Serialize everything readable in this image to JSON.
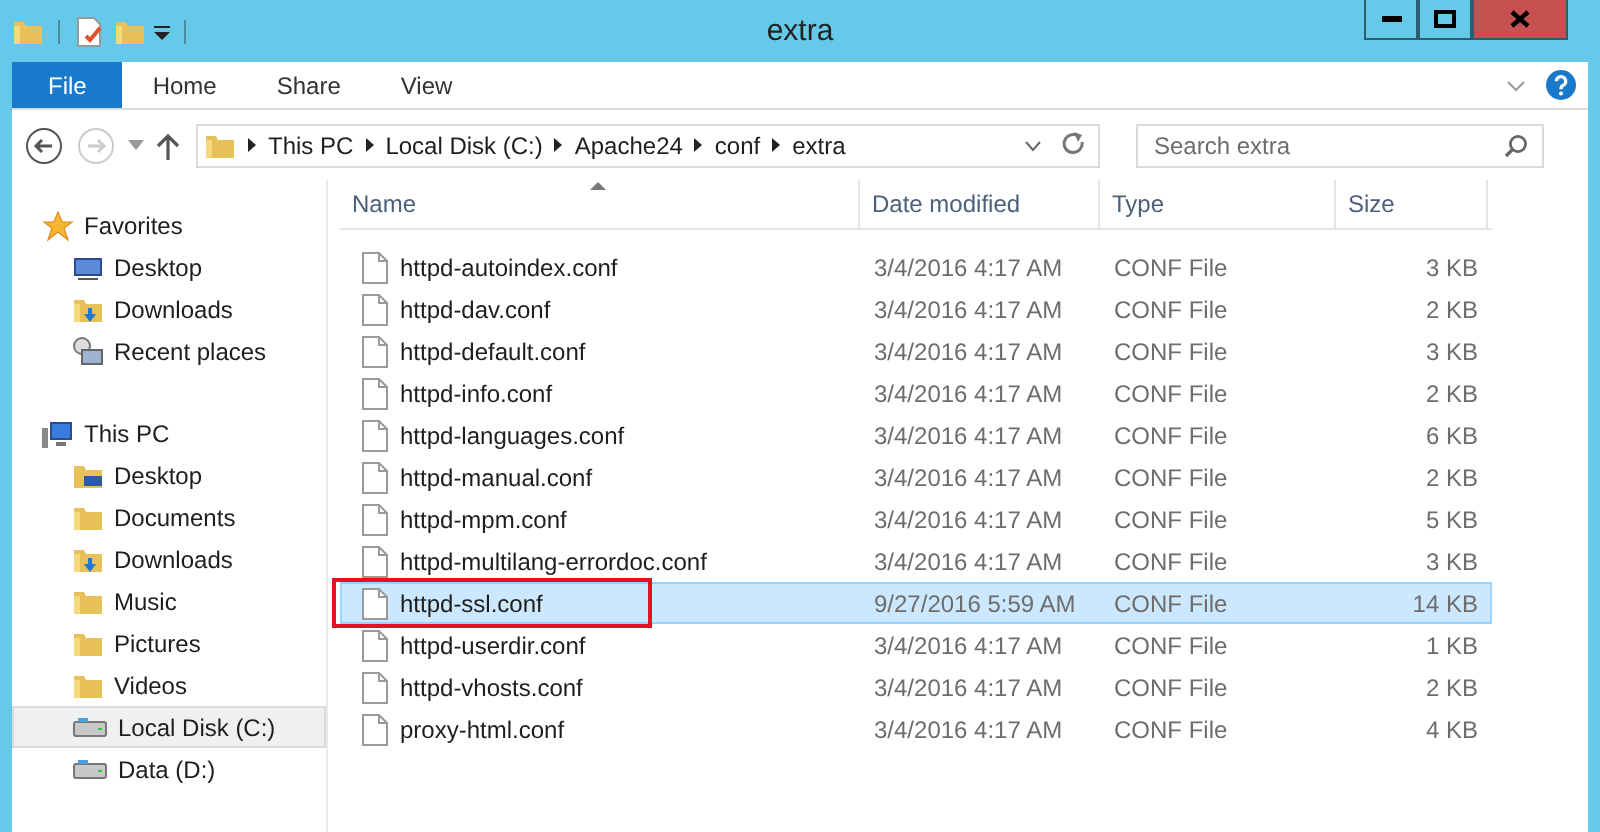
{
  "window": {
    "title": "extra"
  },
  "ribbon_tabs": [
    {
      "label": "File",
      "kind": "file",
      "selected": false
    },
    {
      "label": "Home",
      "kind": "tab",
      "selected": false
    },
    {
      "label": "Share",
      "kind": "tab",
      "selected": false
    },
    {
      "label": "View",
      "kind": "tab",
      "selected": false
    }
  ],
  "address": {
    "crumbs": [
      "This PC",
      "Local Disk (C:)",
      "Apache24",
      "conf",
      "extra"
    ]
  },
  "search": {
    "placeholder": "Search extra"
  },
  "sidebar": {
    "groups": [
      {
        "label": "Favorites",
        "kind": "favorites",
        "children": [
          {
            "label": "Desktop",
            "kind": "desktop",
            "selected": false
          },
          {
            "label": "Downloads",
            "kind": "downloads",
            "selected": false
          },
          {
            "label": "Recent places",
            "kind": "recent",
            "selected": false
          }
        ]
      },
      {
        "label": "This PC",
        "kind": "pc",
        "children": [
          {
            "label": "Desktop",
            "kind": "desktop-folder",
            "selected": false
          },
          {
            "label": "Documents",
            "kind": "folder",
            "selected": false
          },
          {
            "label": "Downloads",
            "kind": "downloads",
            "selected": false
          },
          {
            "label": "Music",
            "kind": "folder",
            "selected": false
          },
          {
            "label": "Pictures",
            "kind": "folder",
            "selected": false
          },
          {
            "label": "Videos",
            "kind": "folder",
            "selected": false
          },
          {
            "label": "Local Disk (C:)",
            "kind": "drive",
            "selected": true
          },
          {
            "label": "Data (D:)",
            "kind": "drive",
            "selected": false
          }
        ]
      }
    ]
  },
  "table": {
    "columns": [
      "Name",
      "Date modified",
      "Type",
      "Size"
    ],
    "rows": [
      {
        "name": "httpd-autoindex.conf",
        "date": "3/4/2016 4:17 AM",
        "type": "CONF File",
        "size": "3 KB",
        "selected": false,
        "highlighted": false
      },
      {
        "name": "httpd-dav.conf",
        "date": "3/4/2016 4:17 AM",
        "type": "CONF File",
        "size": "2 KB",
        "selected": false,
        "highlighted": false
      },
      {
        "name": "httpd-default.conf",
        "date": "3/4/2016 4:17 AM",
        "type": "CONF File",
        "size": "3 KB",
        "selected": false,
        "highlighted": false
      },
      {
        "name": "httpd-info.conf",
        "date": "3/4/2016 4:17 AM",
        "type": "CONF File",
        "size": "2 KB",
        "selected": false,
        "highlighted": false
      },
      {
        "name": "httpd-languages.conf",
        "date": "3/4/2016 4:17 AM",
        "type": "CONF File",
        "size": "6 KB",
        "selected": false,
        "highlighted": false
      },
      {
        "name": "httpd-manual.conf",
        "date": "3/4/2016 4:17 AM",
        "type": "CONF File",
        "size": "2 KB",
        "selected": false,
        "highlighted": false
      },
      {
        "name": "httpd-mpm.conf",
        "date": "3/4/2016 4:17 AM",
        "type": "CONF File",
        "size": "5 KB",
        "selected": false,
        "highlighted": false
      },
      {
        "name": "httpd-multilang-errordoc.conf",
        "date": "3/4/2016 4:17 AM",
        "type": "CONF File",
        "size": "3 KB",
        "selected": false,
        "highlighted": false
      },
      {
        "name": "httpd-ssl.conf",
        "date": "9/27/2016 5:59 AM",
        "type": "CONF File",
        "size": "14 KB",
        "selected": true,
        "highlighted": true
      },
      {
        "name": "httpd-userdir.conf",
        "date": "3/4/2016 4:17 AM",
        "type": "CONF File",
        "size": "1 KB",
        "selected": false,
        "highlighted": false
      },
      {
        "name": "httpd-vhosts.conf",
        "date": "3/4/2016 4:17 AM",
        "type": "CONF File",
        "size": "2 KB",
        "selected": false,
        "highlighted": false
      },
      {
        "name": "proxy-html.conf",
        "date": "3/4/2016 4:17 AM",
        "type": "CONF File",
        "size": "4 KB",
        "selected": false,
        "highlighted": false
      }
    ]
  }
}
